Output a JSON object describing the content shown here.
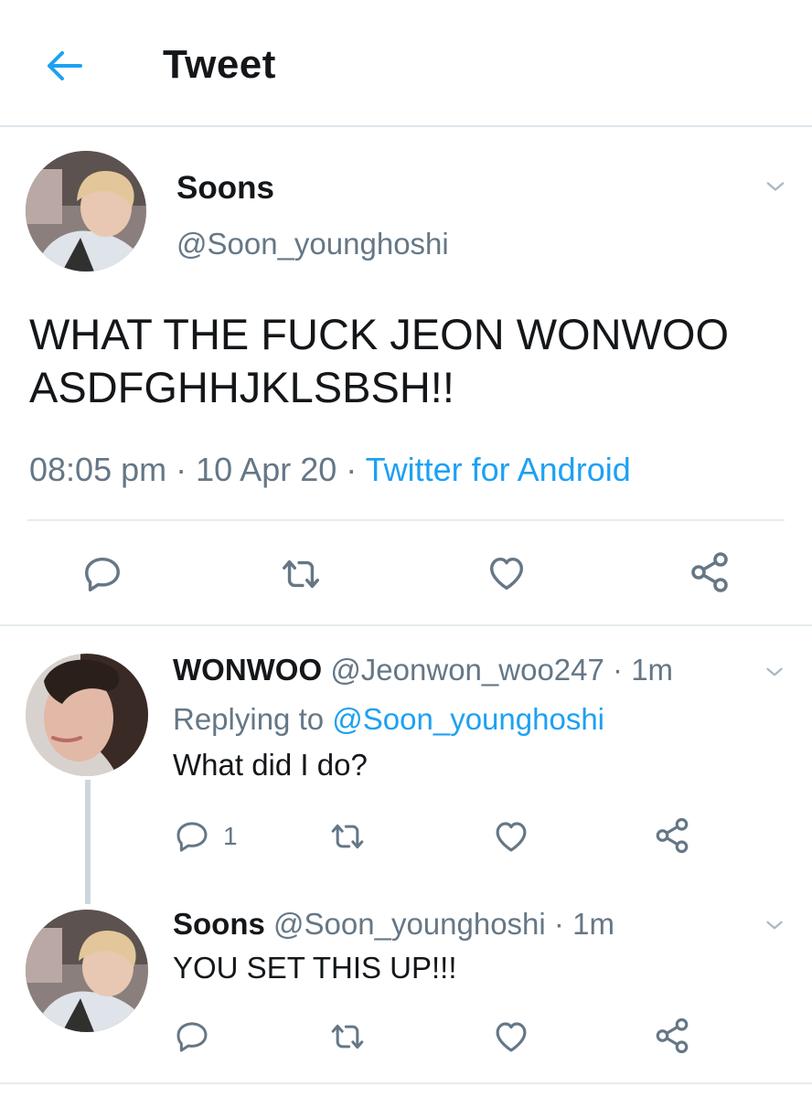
{
  "header": {
    "title": "Tweet",
    "back_icon": "arrow-left-icon",
    "accent": "#1da1f2"
  },
  "main_tweet": {
    "name": "Soons",
    "handle": "@Soon_younghoshi",
    "text": "WHAT THE FUCK JEON WONWOO ASDFGHHJKLSBSH!!",
    "time": "08:05 pm",
    "date": "10 Apr 20",
    "source": "Twitter for Android",
    "actions": [
      "reply-icon",
      "retweet-icon",
      "like-icon",
      "share-icon"
    ]
  },
  "replies": [
    {
      "name": "WONWOO",
      "handle": "@Jeonwon_woo247",
      "time": "1m",
      "replying_label": "Replying to",
      "replying_to": "@Soon_younghoshi",
      "text": "What did I do?",
      "reply_count": "1"
    },
    {
      "name": "Soons",
      "handle": "@Soon_younghoshi",
      "time": "1m",
      "text": "YOU SET THIS UP!!!"
    }
  ],
  "colors": {
    "text": "#14171a",
    "secondary": "#657786",
    "link": "#1da1f2",
    "divider": "#e6ecf0"
  }
}
